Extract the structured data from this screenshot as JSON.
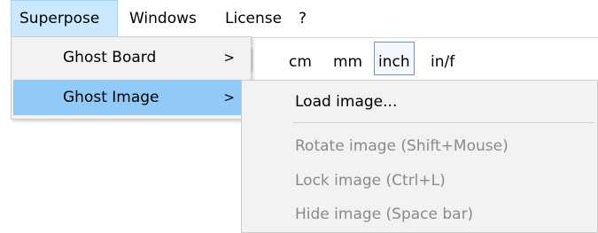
{
  "menubar": {
    "items": [
      {
        "label": "Superpose"
      },
      {
        "label": "Windows"
      },
      {
        "label": "License"
      },
      {
        "label": "?"
      }
    ]
  },
  "toolbar": {
    "units": [
      "cm",
      "mm",
      "inch",
      "in/f"
    ],
    "selected_unit": "inch"
  },
  "superpose_menu": {
    "items": [
      {
        "label": "Ghost Board",
        "arrow": ">"
      },
      {
        "label": "Ghost Image",
        "arrow": ">"
      }
    ]
  },
  "ghost_image_submenu": {
    "items": [
      {
        "label": "Load image..."
      },
      {
        "label": "Rotate image (Shift+Mouse)"
      },
      {
        "label": "Lock image (Ctrl+L)"
      },
      {
        "label": "Hide image (Space bar)"
      }
    ]
  },
  "colors": {
    "menubar_active_bg": "#cce8ff",
    "menu_highlight_bg": "#91c9f7",
    "menu_bg": "#f2f2f2",
    "disabled_text": "#8a8a8a"
  }
}
